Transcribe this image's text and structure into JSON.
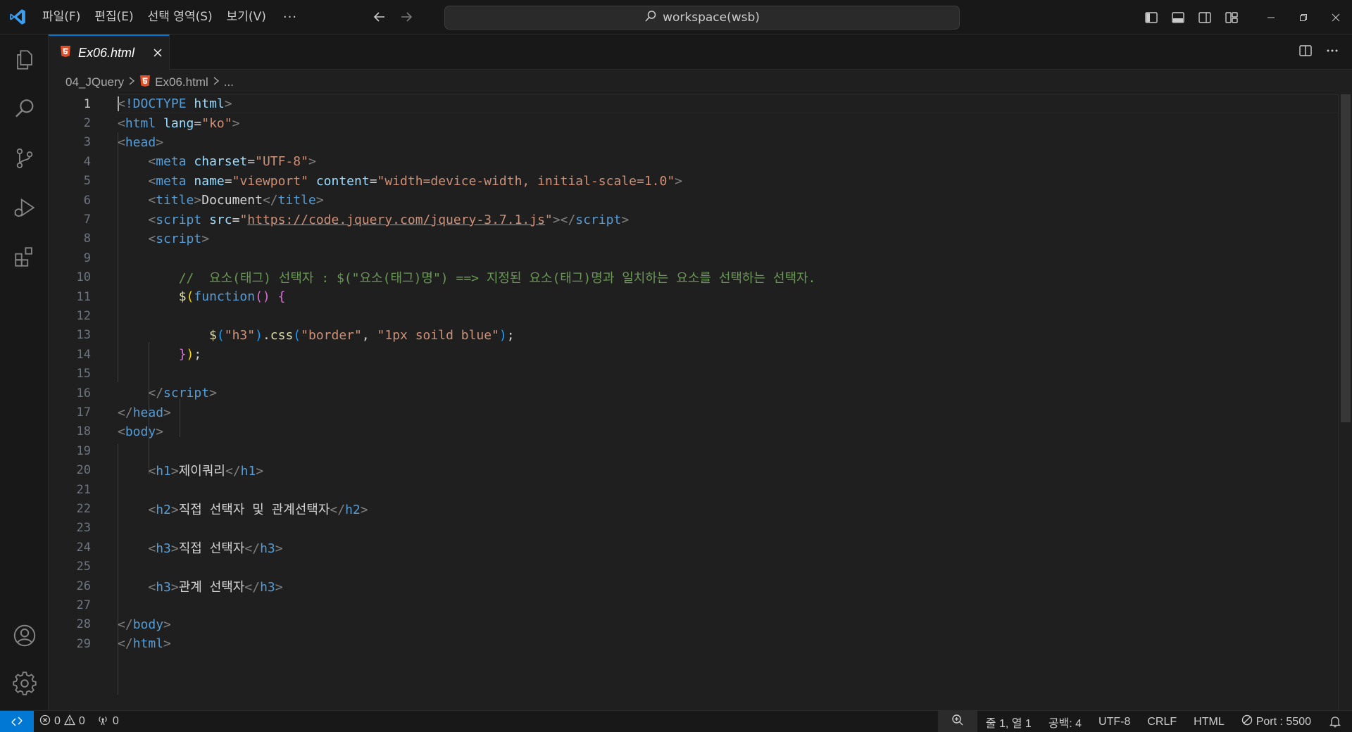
{
  "titlebar": {
    "menu": [
      "파일(F)",
      "편집(E)",
      "선택 영역(S)",
      "보기(V)"
    ],
    "more": "···",
    "search": "workspace(wsb)"
  },
  "tab": {
    "label": "Ex06.html"
  },
  "breadcrumb": {
    "folder": "04_JQuery",
    "file": "Ex06.html",
    "symbol": "..."
  },
  "editor": {
    "active_line": 1,
    "lines": [
      {
        "n": "1"
      },
      {
        "n": "2"
      },
      {
        "n": "3"
      },
      {
        "n": "4"
      },
      {
        "n": "5"
      },
      {
        "n": "6"
      },
      {
        "n": "7"
      },
      {
        "n": "8"
      },
      {
        "n": "9"
      },
      {
        "n": "10"
      },
      {
        "n": "11"
      },
      {
        "n": "12"
      },
      {
        "n": "13"
      },
      {
        "n": "14"
      },
      {
        "n": "15"
      },
      {
        "n": "16"
      },
      {
        "n": "17"
      },
      {
        "n": "18"
      },
      {
        "n": "19"
      },
      {
        "n": "20"
      },
      {
        "n": "21"
      },
      {
        "n": "22"
      },
      {
        "n": "23"
      },
      {
        "n": "24"
      },
      {
        "n": "25"
      },
      {
        "n": "26"
      },
      {
        "n": "27"
      },
      {
        "n": "28"
      },
      {
        "n": "29"
      }
    ],
    "code": {
      "doctype": "!DOCTYPE",
      "html": "html",
      "lang_attr": "lang",
      "lang_val": "\"ko\"",
      "head": "head",
      "meta": "meta",
      "charset_attr": "charset",
      "charset_val": "\"UTF-8\"",
      "name_attr": "name",
      "name_val": "\"viewport\"",
      "content_attr": "content",
      "content_val": "\"width=device-width, initial-scale=1.0\"",
      "title": "title",
      "title_text": "Document",
      "script": "script",
      "src_attr": "src",
      "src_q1": "\"",
      "src_url": "https://code.jquery.com/jquery-3.7.1.js",
      "src_q2": "\"",
      "comment": "//  요소(태그) 선택자 : $(\"요소(태그)명\") ==> 지정된 요소(태그)명과 일치하는 요소를 선택하는 선택자.",
      "dollar": "$",
      "function_kw": "function",
      "selector": "\"h3\"",
      "css_fn": "css",
      "css_prop": "\"border\"",
      "css_val": "\"1px soild blue\"",
      "body": "body",
      "h1": "h1",
      "h1_text": "제이쿼리",
      "h2": "h2",
      "h2_text": "직접 선택자 및 관계선택자",
      "h3": "h3",
      "h3a_text": "직접 선택자",
      "h3b_text": "관계 선택자"
    }
  },
  "statusbar": {
    "errors": "0",
    "warnings": "0",
    "ports": "0",
    "cursor": "줄 1, 열 1",
    "spaces": "공백: 4",
    "encoding": "UTF-8",
    "eol": "CRLF",
    "language": "HTML",
    "live_server": "Port : 5500"
  },
  "colors": {
    "accent": "#0078d4",
    "html_icon": "#e44d26"
  }
}
